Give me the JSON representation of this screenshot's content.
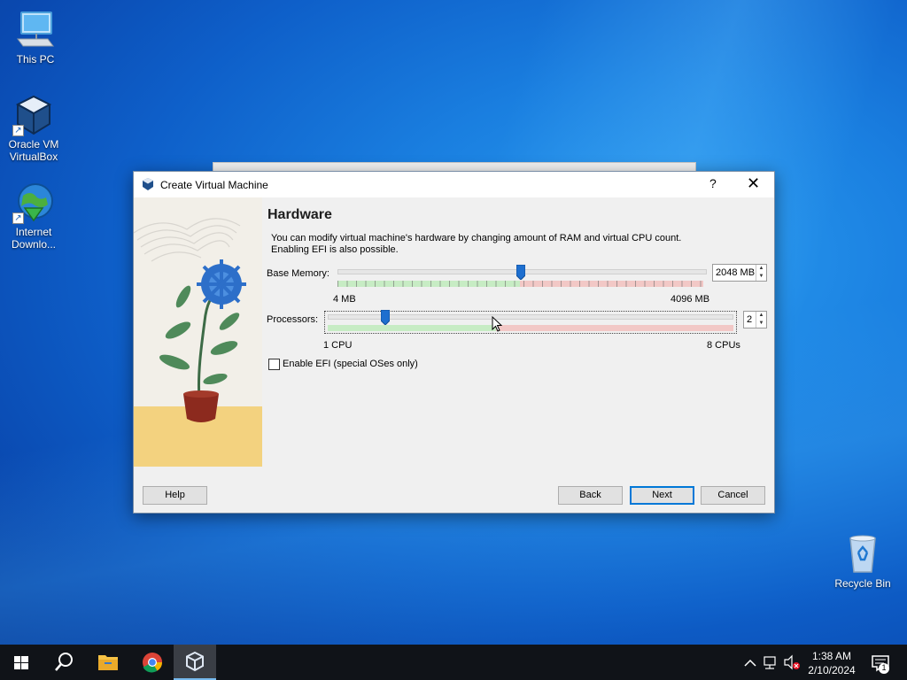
{
  "desktop": {
    "icons": [
      {
        "label": "This PC"
      },
      {
        "label": "Oracle VM VirtualBox"
      },
      {
        "label": "Internet Downlo..."
      },
      {
        "label": "Recycle Bin"
      }
    ]
  },
  "dialog": {
    "title": "Create Virtual Machine",
    "help_glyph": "?",
    "close_glyph": "✕",
    "heading": "Hardware",
    "description": "You can modify virtual machine's hardware by changing amount of RAM and virtual CPU count. Enabling EFI is also possible.",
    "memory": {
      "label": "Base Memory:",
      "value": "2048 MB",
      "min_label": "4 MB",
      "max_label": "4096 MB",
      "fraction": 0.5
    },
    "processors": {
      "label": "Processors:",
      "value": "2",
      "min_label": "1 CPU",
      "max_label": "8 CPUs",
      "fraction": 0.143
    },
    "efi": {
      "label": "Enable EFI (special OSes only)",
      "checked": false
    },
    "buttons": {
      "help": "Help",
      "back": "Back",
      "next": "Next",
      "cancel": "Cancel"
    }
  },
  "taskbar": {
    "time": "1:38 AM",
    "date": "2/10/2024",
    "notification_count": "1"
  },
  "colors": {
    "accent": "#0078d7",
    "slider_safe": "#c7ecc4",
    "slider_danger": "#f2c8c6",
    "taskbar": "#101318"
  }
}
